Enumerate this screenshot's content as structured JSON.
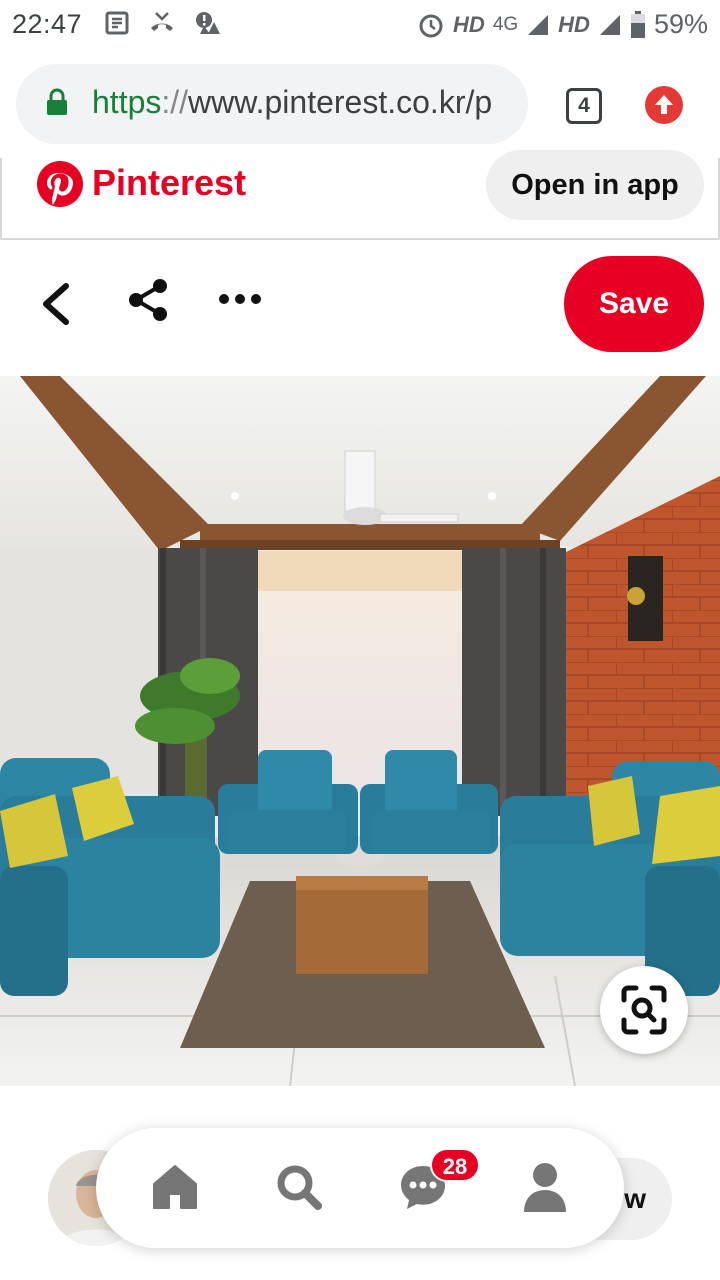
{
  "status_bar": {
    "time": "22:47",
    "network_1": "HD",
    "network_type": "4G",
    "network_2": "HD",
    "battery": "59%"
  },
  "browser": {
    "url_scheme": "https",
    "url_separator": "://",
    "url_rest": "www.pinterest.co.kr/p",
    "tab_count": "4"
  },
  "banner": {
    "brand": "Pinterest",
    "open_in_app": "Open in app"
  },
  "pin_actions": {
    "save_label": "Save"
  },
  "bottom": {
    "follow_label_visible": "w",
    "notifications_badge": "28"
  },
  "colors": {
    "brand_red": "#e60023",
    "url_green": "#188038"
  },
  "icons": [
    "alarm-icon",
    "signal-icon",
    "battery-icon",
    "lock-icon",
    "upload-icon",
    "back-icon",
    "share-icon",
    "more-icon",
    "visual-search-icon",
    "home-icon",
    "search-icon",
    "messages-icon",
    "profile-icon"
  ]
}
